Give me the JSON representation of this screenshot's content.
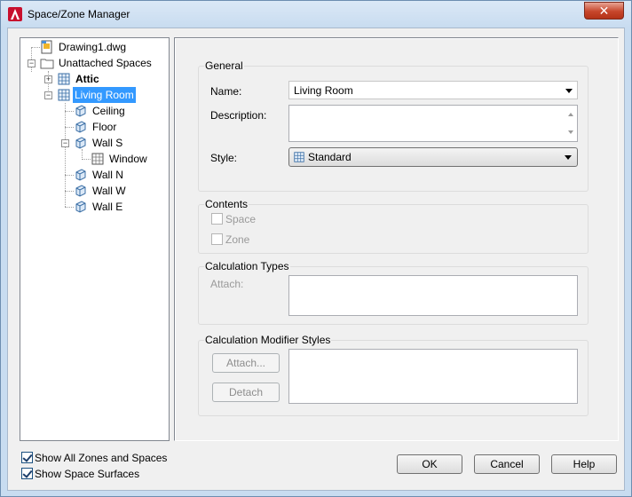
{
  "window": {
    "title": "Space/Zone Manager",
    "close_label": "✕"
  },
  "tree": {
    "items": [
      {
        "label": "Drawing1.dwg"
      },
      {
        "label": "Unattached Spaces"
      },
      {
        "label": "Attic"
      },
      {
        "label": "Living Room"
      },
      {
        "label": "Ceiling"
      },
      {
        "label": "Floor"
      },
      {
        "label": "Wall S"
      },
      {
        "label": "Window"
      },
      {
        "label": "Wall N"
      },
      {
        "label": "Wall W"
      },
      {
        "label": "Wall E"
      }
    ],
    "expander_plus": "+",
    "expander_minus": "−"
  },
  "general": {
    "title": "General",
    "name_label": "Name:",
    "name_value": "Living Room",
    "description_label": "Description:",
    "description_value": "",
    "style_label": "Style:",
    "style_value": "Standard"
  },
  "contents": {
    "title": "Contents",
    "space_label": "Space",
    "zone_label": "Zone"
  },
  "calculation_types": {
    "title": "Calculation Types",
    "attach_label": "Attach:"
  },
  "calculation_modifier_styles": {
    "title": "Calculation Modifier Styles",
    "attach_button": "Attach...",
    "detach_button": "Detach"
  },
  "options": {
    "show_all_label": "Show All Zones and Spaces",
    "show_surfaces_label": "Show Space Surfaces"
  },
  "buttons": {
    "ok": "OK",
    "cancel": "Cancel",
    "help": "Help"
  }
}
